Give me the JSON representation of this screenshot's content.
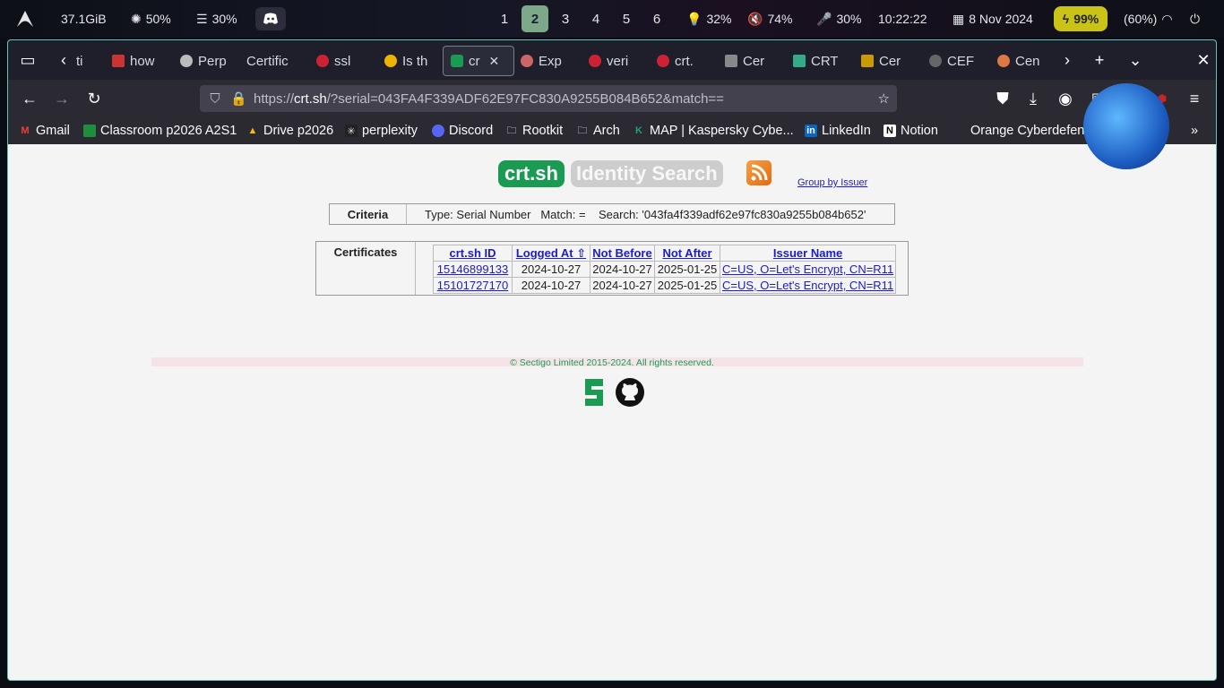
{
  "topbar": {
    "memory": "37.1GiB",
    "cpu": "50%",
    "disk": "30%",
    "workspaces": [
      "1",
      "2",
      "3",
      "4",
      "5",
      "6"
    ],
    "active_workspace": "2",
    "brightness": "32%",
    "volume": "74%",
    "mic": "30%",
    "time": "10:22:22",
    "date": "8 Nov 2024",
    "battery": "99%",
    "wifi": "(60%)"
  },
  "tabs": [
    {
      "label": "ti",
      "fav": "#777"
    },
    {
      "label": "how",
      "fav": "#c33"
    },
    {
      "label": "Perp",
      "fav": "#bbb"
    },
    {
      "label": "Certific",
      "fav": ""
    },
    {
      "label": "ssl",
      "fav": "#c23"
    },
    {
      "label": "Is th",
      "fav": "#f0b400"
    },
    {
      "label": "cr",
      "fav": "#1a9b52"
    },
    {
      "label": "Exp",
      "fav": "#c66"
    },
    {
      "label": "veri",
      "fav": "#c23"
    },
    {
      "label": "crt.",
      "fav": "#c23"
    },
    {
      "label": "Cer",
      "fav": "#888"
    },
    {
      "label": "CRT",
      "fav": "#3a8"
    },
    {
      "label": "Cer",
      "fav": "#c90"
    },
    {
      "label": "CEF",
      "fav": "#666"
    },
    {
      "label": "Cen",
      "fav": "#d74"
    }
  ],
  "url": {
    "prefix": "https://",
    "host": "crt.sh",
    "path": "/?serial=043FA4F339ADF62E97FC830A9255B084B652&match=="
  },
  "bookmarks": [
    {
      "label": "Gmail"
    },
    {
      "label": "Classroom p2026 A2S1"
    },
    {
      "label": "Drive p2026"
    },
    {
      "label": "perplexity"
    },
    {
      "label": "Discord"
    },
    {
      "label": "Rootkit"
    },
    {
      "label": "Arch"
    },
    {
      "label": "MAP | Kaspersky Cybe..."
    },
    {
      "label": "LinkedIn"
    },
    {
      "label": "Notion"
    },
    {
      "label": "Orange Cyberdefense ..."
    }
  ],
  "page": {
    "logo_main": "crt.sh",
    "logo_sub": "Identity Search",
    "group_link": "Group by Issuer",
    "criteria_label": "Criteria",
    "criteria_value": "Type: Serial Number   Match: =    Search: '043fa4f339adf62e97fc830a9255b084b652'",
    "certs_label": "Certificates",
    "columns": [
      "crt.sh ID",
      "Logged At  ⇧",
      "Not Before",
      "Not After",
      "Issuer Name"
    ],
    "rows": [
      [
        "15146899133",
        "2024-10-27",
        "2024-10-27",
        "2025-01-25",
        "C=US, O=Let's Encrypt, CN=R11"
      ],
      [
        "15101727170",
        "2024-10-27",
        "2024-10-27",
        "2025-01-25",
        "C=US, O=Let's Encrypt, CN=R11"
      ]
    ],
    "footer": "© Sectigo Limited 2015-2024. All rights reserved."
  }
}
